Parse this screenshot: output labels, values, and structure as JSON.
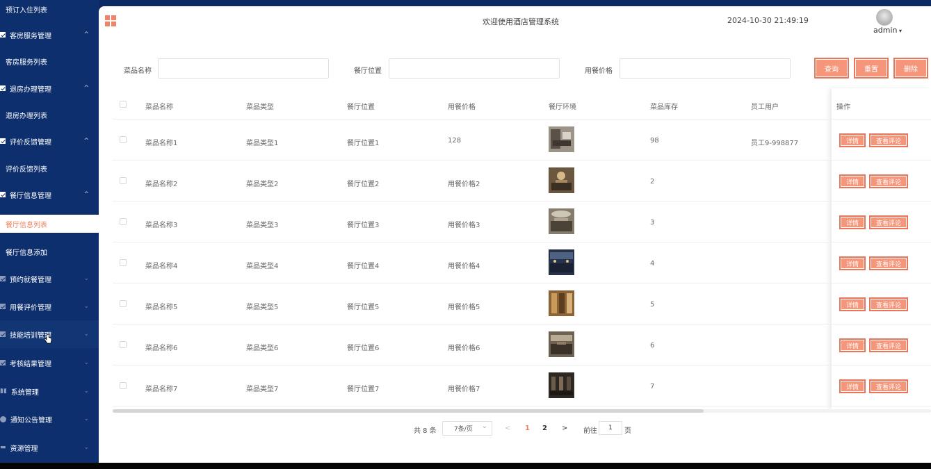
{
  "sidebar": {
    "items": [
      {
        "label": "预订入住列表",
        "type": "sub",
        "state": "normal"
      },
      {
        "label": "客房服务管理",
        "type": "head",
        "state": "open"
      },
      {
        "label": "客房服务列表",
        "type": "sub",
        "state": "normal"
      },
      {
        "label": "退房办理管理",
        "type": "head",
        "state": "open"
      },
      {
        "label": "退房办理列表",
        "type": "sub",
        "state": "normal"
      },
      {
        "label": "评价反馈管理",
        "type": "head",
        "state": "open"
      },
      {
        "label": "评价反馈列表",
        "type": "sub",
        "state": "normal"
      },
      {
        "label": "餐厅信息管理",
        "type": "head",
        "state": "open"
      },
      {
        "label": "餐厅信息列表",
        "type": "sub",
        "state": "active"
      },
      {
        "label": "餐厅信息添加",
        "type": "sub",
        "state": "normal"
      },
      {
        "label": "预约就餐管理",
        "type": "head",
        "state": "closed"
      },
      {
        "label": "用餐评价管理",
        "type": "head",
        "state": "closed"
      },
      {
        "label": "技能培训管理",
        "type": "head",
        "state": "closed"
      },
      {
        "label": "考核结果管理",
        "type": "head",
        "state": "closed"
      },
      {
        "label": "系统管理",
        "type": "head",
        "state": "closed"
      },
      {
        "label": "通知公告管理",
        "type": "head",
        "state": "closed"
      },
      {
        "label": "资源管理",
        "type": "head",
        "state": "closed"
      }
    ],
    "chevron_up": "^",
    "chevron_down": "⌄"
  },
  "header": {
    "welcome": "欢迎使用酒店管理系统",
    "datetime": "2024-10-30 21:49:19",
    "user": "admin"
  },
  "search": {
    "dish_name_label": "菜品名称",
    "dish_name_value": "",
    "location_label": "餐厅位置",
    "location_value": "",
    "price_label": "用餐价格",
    "price_value": "",
    "query_button": "查询",
    "reset_button": "重置",
    "delete_button": "删除"
  },
  "table": {
    "headers": [
      "菜品名称",
      "菜品类型",
      "餐厅位置",
      "用餐价格",
      "餐厅环境",
      "菜品库存",
      "员工用户",
      "操作"
    ],
    "rows": [
      {
        "name": "菜品名称1",
        "type": "菜品类型1",
        "location": "餐厅位置1",
        "price": "128",
        "stock": "98",
        "staff": "员工9-998877"
      },
      {
        "name": "菜品名称2",
        "type": "菜品类型2",
        "location": "餐厅位置2",
        "price": "用餐价格2",
        "stock": "2",
        "staff": ""
      },
      {
        "name": "菜品名称3",
        "type": "菜品类型3",
        "location": "餐厅位置3",
        "price": "用餐价格3",
        "stock": "3",
        "staff": ""
      },
      {
        "name": "菜品名称4",
        "type": "菜品类型4",
        "location": "餐厅位置4",
        "price": "用餐价格4",
        "stock": "4",
        "staff": ""
      },
      {
        "name": "菜品名称5",
        "type": "菜品类型5",
        "location": "餐厅位置5",
        "price": "用餐价格5",
        "stock": "5",
        "staff": ""
      },
      {
        "name": "菜品名称6",
        "type": "菜品类型6",
        "location": "餐厅位置6",
        "price": "用餐价格6",
        "stock": "6",
        "staff": ""
      },
      {
        "name": "菜品名称7",
        "type": "菜品类型7",
        "location": "餐厅位置7",
        "price": "用餐价格7",
        "stock": "7",
        "staff": ""
      }
    ],
    "detail_button": "详情",
    "review_button": "查看评论"
  },
  "pagination": {
    "total": "共 8 条",
    "page_size": "7条/页",
    "prev": "<",
    "pages": [
      "1",
      "2"
    ],
    "next": ">",
    "goto_label": "前往",
    "goto_value": "1",
    "goto_suffix": "页"
  },
  "colors": {
    "sidebar_bg": "#0b2a63",
    "accent": "#f5957a",
    "accent_border": "#e8765a",
    "active_text": "#f08060"
  }
}
